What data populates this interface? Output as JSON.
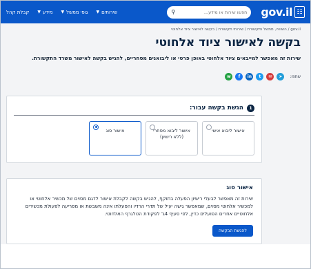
{
  "header": {
    "logo_text": "gov.il",
    "logo_emblem": "☷",
    "search_placeholder": "חפשו שירות או מידע...",
    "nav": [
      {
        "label": "שירותים"
      },
      {
        "label": "גופי ממשל"
      },
      {
        "label": "מידע"
      }
    ],
    "accessibility_label": "קבלת קהל"
  },
  "breadcrumb": "gov.il / השוויה, ממשל ותקשורת / שירותי תקשורת / בקשה לאישור ציוד אלחוטי",
  "page_title": "בקשה לאישור ציוד אלחוטי",
  "lead": "שירות זה מאפשר למייבאים ציוד אלחוטי באופן פרטי או ליבואנים מסחריים, להגיש בקשה לאישור משרד התקשורת.",
  "share": {
    "label": "שתפו:",
    "icons": [
      {
        "name": "whatsapp-icon",
        "glyph": "w",
        "color": "#25a244"
      },
      {
        "name": "facebook-icon",
        "glyph": "f",
        "color": "#1877f2"
      },
      {
        "name": "linkedin-icon",
        "glyph": "in",
        "color": "#0a66c2"
      },
      {
        "name": "twitter-icon",
        "glyph": "t",
        "color": "#1d9bf0"
      },
      {
        "name": "email-icon",
        "glyph": "✉",
        "color": "#d43b3b"
      },
      {
        "name": "telegram-icon",
        "glyph": "➤",
        "color": "#229ed9"
      }
    ]
  },
  "request_card": {
    "step_number": "1",
    "step_title": "הגשת בקשה עבור:",
    "options": [
      {
        "label": "אישור ליבוא אישי",
        "selected": false
      },
      {
        "label": "אישור ליבוא מסחרי (ללא רישיון)",
        "selected": false
      },
      {
        "label": "אישור סוג",
        "selected": true
      }
    ]
  },
  "info": {
    "title": "אישור סוג",
    "text": "שירות זה מאפשר לבעלי רישיון הפעלה בתוקף, להגיש בקשה לקבלת אישור לדגם מסוים של מכשיר אלחוטי או למכשיר אלחוטי מסוים, שמאפשר גישה יעיל של תדרי הרדיו והפעלתו אינה משבשת או מפריעה לפעולת מכשירים אלחוטיים אחרים הפועלים כדין, לפי סעיף 4ג' לפקודת הטלגרף האלחוטי.",
    "button_label": "להגשת הבקשה"
  },
  "colors": {
    "brand_blue": "#0a58ca",
    "title_navy": "#0b2543"
  }
}
